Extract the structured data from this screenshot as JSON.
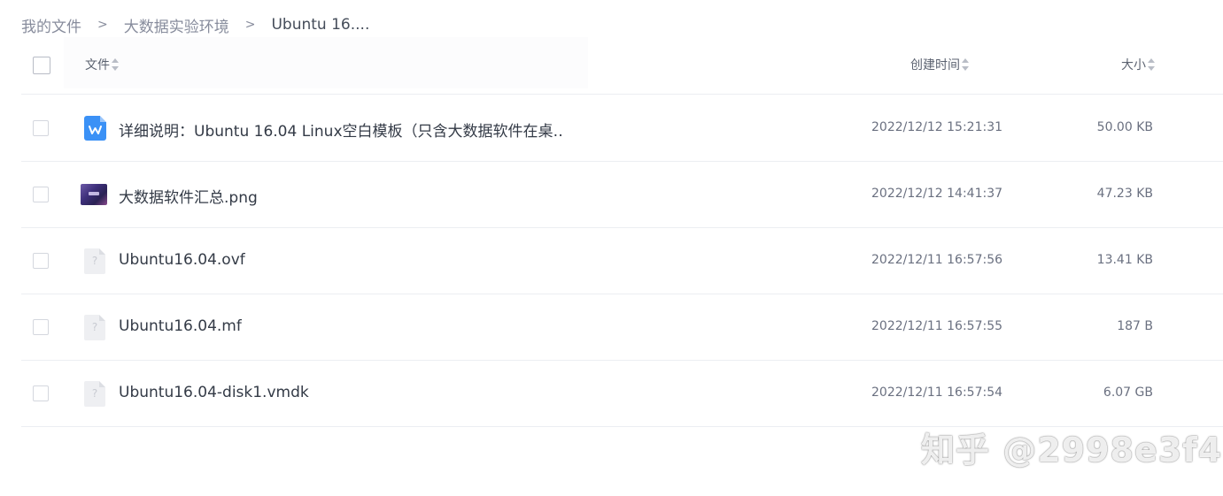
{
  "breadcrumb": {
    "items": [
      "我的文件",
      "大数据实验环境",
      "Ubuntu 16...."
    ],
    "separator": ">"
  },
  "table": {
    "columns": {
      "name": "文件",
      "created": "创建时间",
      "size": "大小"
    },
    "rows": [
      {
        "name": "详细说明：Ubuntu 16.04 Linux空白模板（只含大数据软件在桌…",
        "created": "2022/12/12 15:21:31",
        "size": "50.00 KB",
        "icon": "wps-doc-icon"
      },
      {
        "name": "大数据软件汇总.png",
        "created": "2022/12/12 14:41:37",
        "size": "47.23 KB",
        "icon": "image-thumbnail-icon"
      },
      {
        "name": "Ubuntu16.04.ovf",
        "created": "2022/12/11 16:57:56",
        "size": "13.41 KB",
        "icon": "unknown-file-icon"
      },
      {
        "name": "Ubuntu16.04.mf",
        "created": "2022/12/11 16:57:55",
        "size": "187 B",
        "icon": "unknown-file-icon"
      },
      {
        "name": "Ubuntu16.04-disk1.vmdk",
        "created": "2022/12/11 16:57:54",
        "size": "6.07 GB",
        "icon": "unknown-file-icon"
      }
    ]
  },
  "watermark": "知乎 @2998e3f4",
  "colors": {
    "accent": "#3b91f6",
    "text_primary": "#333a46",
    "text_secondary": "#6a7080",
    "divider": "#eceef2"
  }
}
